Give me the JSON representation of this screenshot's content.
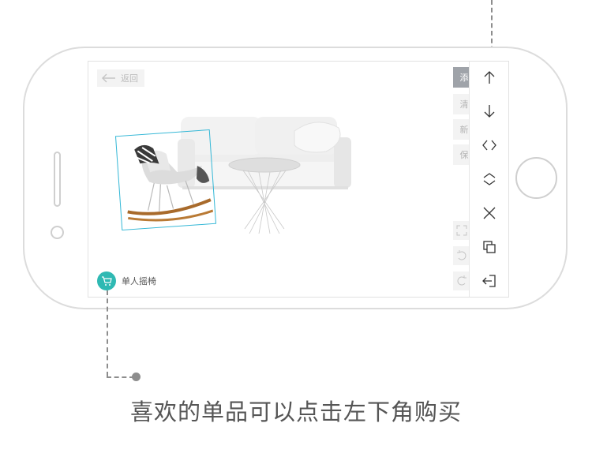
{
  "screen": {
    "back_label": "返回",
    "side_tabs": [
      "添",
      "清",
      "新",
      "保"
    ],
    "toolbar": {
      "icons": [
        "arrow-up-icon",
        "arrow-down-icon",
        "flip-horizontal-icon",
        "flip-vertical-icon",
        "close-icon",
        "copy-icon",
        "exit-icon"
      ]
    },
    "product": {
      "label": "单人摇椅"
    }
  },
  "caption": "喜欢的单品可以点击左下角购买",
  "colors": {
    "accent": "#2fb9b3",
    "selection": "#33b7d6",
    "active_tab": "#9fa3a9"
  }
}
